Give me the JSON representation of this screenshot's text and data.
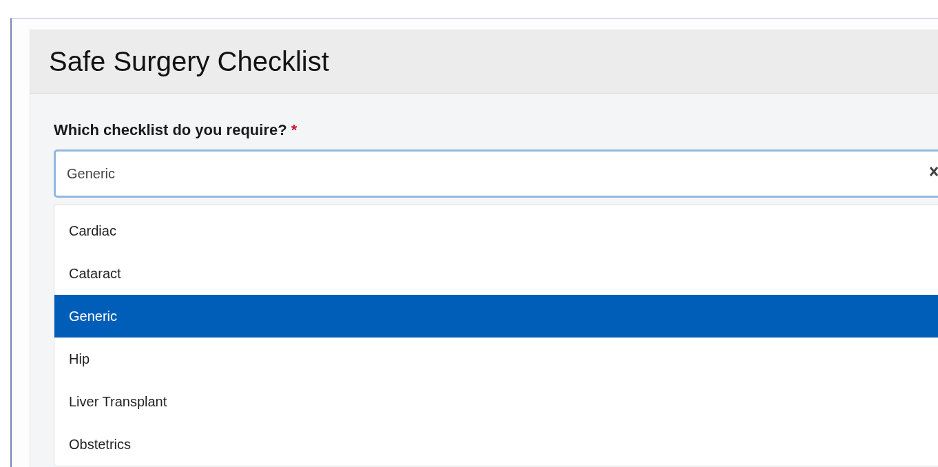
{
  "page": {
    "title": "Safe Surgery Checklist"
  },
  "question": {
    "label": "Which checklist do you require?",
    "required_mark": "*",
    "value": "Generic"
  },
  "options": [
    {
      "label": "Cardiac",
      "selected": false
    },
    {
      "label": "Cataract",
      "selected": false
    },
    {
      "label": "Generic",
      "selected": true
    },
    {
      "label": "Hip",
      "selected": false
    },
    {
      "label": "Liver Transplant",
      "selected": false
    },
    {
      "label": "Obstetrics",
      "selected": false
    }
  ]
}
